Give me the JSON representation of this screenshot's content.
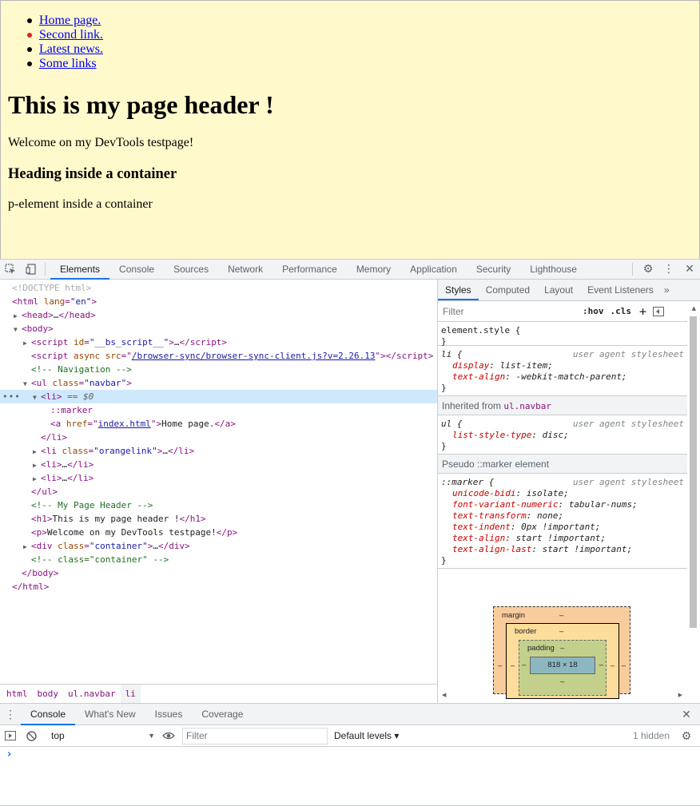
{
  "page": {
    "nav_links": [
      "Home page.",
      "Second link.",
      "Latest news.",
      "Some links"
    ],
    "header": "This is my page header !",
    "welcome": "Welcome on my DevTools testpage!",
    "container_heading": "Heading inside a container",
    "container_text": "p-element inside a container"
  },
  "devtools": {
    "tabs": [
      "Elements",
      "Console",
      "Sources",
      "Network",
      "Performance",
      "Memory",
      "Application",
      "Security",
      "Lighthouse"
    ],
    "active_tab": "Elements"
  },
  "elements_tree": {
    "doctype": "<!DOCTYPE html>",
    "html_open": "html",
    "lang_attr": "lang",
    "lang_val": "\"en\"",
    "head": "head",
    "body": "body",
    "script1_id": "\"__bs_script__\"",
    "script2_src": "/browser-sync/browser-sync-client.js?v=2.26.13",
    "comment_nav": "<!-- Navigation -->",
    "ul_class": "\"navbar\"",
    "selected_eq": "== $0",
    "marker": "::marker",
    "a_href": "index.html",
    "a_text": "Home page.",
    "li_class_orange": "\"orangelink\"",
    "comment_header": "<!-- My Page Header -->",
    "h1_text": "This is my page header !",
    "p_text": "Welcome on my DevTools testpage!",
    "div_class": "\"container\"",
    "comment_container": "<!-- class=\"container\" -->"
  },
  "breadcrumbs": [
    "html",
    "body",
    "ul.navbar",
    "li"
  ],
  "styles": {
    "tabs": [
      "Styles",
      "Computed",
      "Layout",
      "Event Listeners"
    ],
    "filter_placeholder": "Filter",
    "hov": ":hov",
    "cls": ".cls",
    "element_style": "element.style {",
    "li_selector": "li {",
    "ua_source": "user agent stylesheet",
    "li_decls": [
      [
        "display",
        "list-item;"
      ],
      [
        "text-align",
        "-webkit-match-parent;"
      ]
    ],
    "inherited_label": "Inherited from",
    "inherited_from": "ul.navbar",
    "ul_selector": "ul {",
    "ul_decls": [
      [
        "list-style-type",
        "disc;"
      ]
    ],
    "pseudo_label": "Pseudo ::marker element",
    "marker_selector": "::marker {",
    "marker_decls": [
      [
        "unicode-bidi",
        "isolate;"
      ],
      [
        "font-variant-numeric",
        "tabular-nums;"
      ],
      [
        "text-transform",
        "none;"
      ],
      [
        "text-indent",
        "0px !important;"
      ],
      [
        "text-align",
        "start !important;"
      ],
      [
        "text-align-last",
        "start !important;"
      ]
    ],
    "close_brace": "}",
    "box_model": {
      "margin": "margin",
      "border": "border",
      "padding": "padding",
      "content": "818 × 18",
      "dash": "–"
    }
  },
  "console": {
    "drawer_tabs": [
      "Console",
      "What's New",
      "Issues",
      "Coverage"
    ],
    "context": "top",
    "filter_placeholder": "Filter",
    "levels": "Default levels ▾",
    "hidden": "1 hidden",
    "prompt": "›"
  }
}
